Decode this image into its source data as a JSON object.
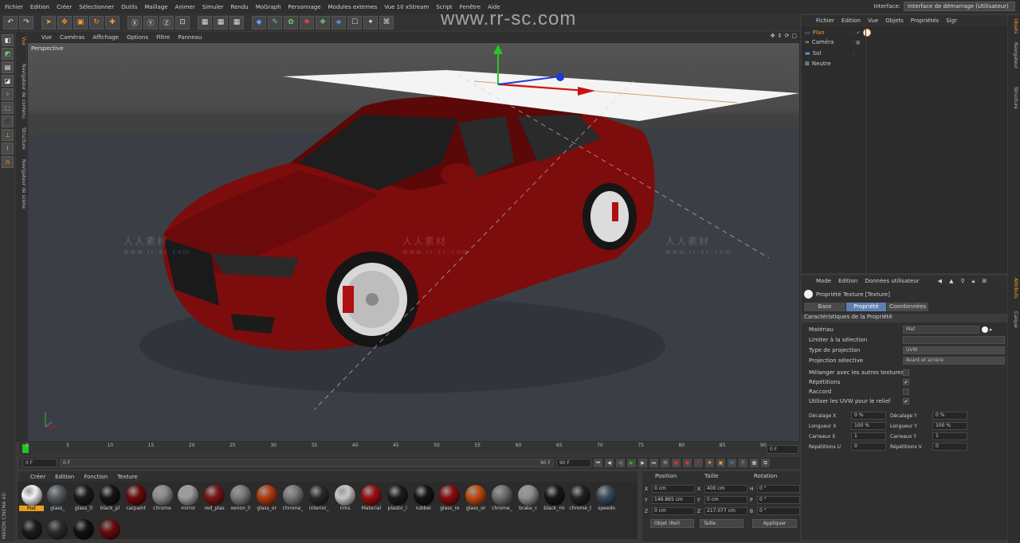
{
  "menubar": {
    "items": [
      "Fichier",
      "Edition",
      "Créer",
      "Sélectionner",
      "Outils",
      "Maillage",
      "Animer",
      "Simuler",
      "Rendu",
      "MoGraph",
      "Personnage",
      "Modules externes",
      "Vue 10 xStream",
      "Script",
      "Fenêtre",
      "Aide"
    ],
    "interface_label": "Interface:",
    "interface_value": "Interface de démarrage (Utilisateur)"
  },
  "watermark": {
    "main": "www.rr-sc.com",
    "cn": "人人素材",
    "sub": "www.rr-sc.com"
  },
  "viewport": {
    "menu": [
      "Vue",
      "Caméras",
      "Affichage",
      "Options",
      "Filtre",
      "Panneau"
    ],
    "label": "Perspective"
  },
  "timeline": {
    "ticks": [
      "0",
      "5",
      "10",
      "15",
      "20",
      "25",
      "30",
      "35",
      "40",
      "45",
      "50",
      "55",
      "60",
      "65",
      "70",
      "75",
      "80",
      "85",
      "90"
    ],
    "current_frame": "0 F",
    "start": "0 F",
    "start2": "0 F",
    "end": "90 F",
    "end2": "90 F"
  },
  "materials": {
    "menu": [
      "Créer",
      "Edition",
      "Fonction",
      "Texture"
    ],
    "logo": "MAXON CINEMA 4D",
    "items": [
      {
        "label": "Mat",
        "color": "#f2f2f2"
      },
      {
        "label": "glass_",
        "color": "#555a5e"
      },
      {
        "label": "glass_tl",
        "color": "#1b1b1b"
      },
      {
        "label": "black_pl",
        "color": "#151515"
      },
      {
        "label": "carpaint",
        "color": "#6e0a0a"
      },
      {
        "label": "chrome",
        "color": "#8a8a8a"
      },
      {
        "label": "mirror",
        "color": "#9c9c9c"
      },
      {
        "label": "red_plas",
        "color": "#7a1515"
      },
      {
        "label": "xenon_li",
        "color": "#7a7a7a"
      },
      {
        "label": "glass_or",
        "color": "#b33a10"
      },
      {
        "label": "chrome_",
        "color": "#777"
      },
      {
        "label": "interior_",
        "color": "#2a2a2a"
      },
      {
        "label": "rims",
        "color": "#c8c8c8"
      },
      {
        "label": "Material",
        "color": "#9a1010"
      },
      {
        "label": "plastic_l",
        "color": "#1c1c1c"
      },
      {
        "label": "rubber",
        "color": "#141414"
      },
      {
        "label": "glass_re",
        "color": "#8a0d0d"
      },
      {
        "label": "glass_or",
        "color": "#c04a10"
      },
      {
        "label": "chrome_",
        "color": "#6e6e6e"
      },
      {
        "label": "brake_c",
        "color": "#8f8f8f"
      },
      {
        "label": "black_mi",
        "color": "#181818"
      },
      {
        "label": "chrome_t",
        "color": "#222"
      },
      {
        "label": "speedo",
        "color": "#3a4a5a"
      }
    ],
    "row2": [
      {
        "color": "#1d1d1d"
      },
      {
        "color": "#2d2d2d"
      },
      {
        "color": "#121212"
      },
      {
        "color": "#6a0c0c"
      }
    ]
  },
  "coords": {
    "headers": [
      "Position",
      "Taille",
      "Rotation"
    ],
    "rows": [
      {
        "ax1": "X",
        "pos": "0 cm",
        "ax2": "X",
        "size": "400 cm",
        "ax3": "H",
        "rot": "0 °"
      },
      {
        "ax1": "Y",
        "pos": "149.865 cm",
        "ax2": "Y",
        "size": "0 cm",
        "ax3": "P",
        "rot": "0 °"
      },
      {
        "ax1": "Z",
        "pos": "0 cm",
        "ax2": "Z",
        "size": "217.077 cm",
        "ax3": "B",
        "rot": "0 °"
      }
    ],
    "mode": "Objet (Rel)",
    "size_mode": "Taille",
    "apply": "Appliquer"
  },
  "objects": {
    "menu": [
      "Fichier",
      "Edition",
      "Vue",
      "Objets",
      "Propriétés",
      "Sigr"
    ],
    "items": [
      {
        "name": "Plan",
        "color": "#ff9a2e"
      },
      {
        "name": "Caméra",
        "color": "#cfcfcf"
      },
      {
        "name": "Sol",
        "color": "#cfcfcf"
      },
      {
        "name": "Neutre",
        "color": "#cfcfcf"
      }
    ]
  },
  "right_tabs": [
    "Objets",
    "Navigateur",
    "Structure",
    "Attributs",
    "Calque"
  ],
  "left_strip_tabs": [
    "Vue",
    "Navigateur de contenu",
    "Structure",
    "Navigateur de scène"
  ],
  "attributes": {
    "menu": [
      "Mode",
      "Edition",
      "Données utilisateur"
    ],
    "title": "Propriété Texture [Texture]",
    "tabs": [
      "Base",
      "Propriété",
      "Coordonnées"
    ],
    "section": "Caractéristiques de la Propriété",
    "rows": [
      {
        "label": "Matériau",
        "value": "Mat"
      },
      {
        "label": "Limiter à la sélection",
        "value": ""
      },
      {
        "label": "Type de projection",
        "value": "UVW"
      },
      {
        "label": "Projection sélective",
        "value": "Avant et arrière"
      }
    ],
    "checks": [
      {
        "label": "Mélanger avec les autres textures",
        "checked": false
      },
      {
        "label": "Répétitions",
        "checked": true
      },
      {
        "label": "Raccord",
        "checked": false
      },
      {
        "label": "Utiliser les UVW pour le relief",
        "checked": true
      }
    ],
    "pairs": [
      {
        "l1": "Décalage X",
        "v1": "0 %",
        "l2": "Décalage Y",
        "v2": "0 %"
      },
      {
        "l1": "Longueur X",
        "v1": "100 %",
        "l2": "Longueur Y",
        "v2": "100 %"
      },
      {
        "l1": "Carreaux X",
        "v1": "1",
        "l2": "Carreaux Y",
        "v2": "1"
      },
      {
        "l1": "Répétitions U",
        "v1": "0",
        "l2": "Répétitions V",
        "v2": "0"
      }
    ]
  }
}
